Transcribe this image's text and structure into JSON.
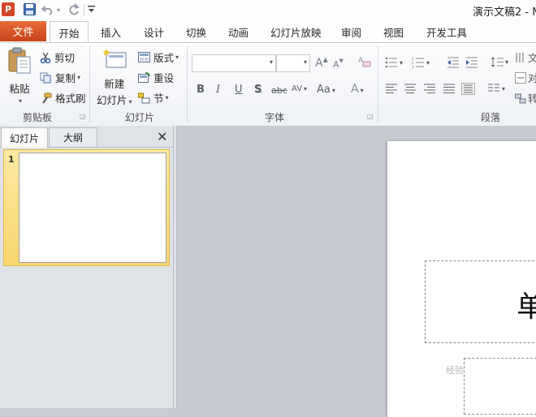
{
  "title_bar": {
    "app_icon_letter": "P",
    "document_title": "演示文稿2 - M"
  },
  "tabs": [
    "文件",
    "开始",
    "插入",
    "设计",
    "切换",
    "动画",
    "幻灯片放映",
    "审阅",
    "视图",
    "开发工具"
  ],
  "active_tab": "开始",
  "ribbon": {
    "clipboard": {
      "paste_label": "粘贴",
      "cut_label": "剪切",
      "copy_label": "复制",
      "format_painter_label": "格式刷",
      "group_label": "剪贴板"
    },
    "slides": {
      "new_slide_line1": "新建",
      "new_slide_line2": "幻灯片",
      "layout_label": "版式",
      "reset_label": "重设",
      "section_label": "节",
      "group_label": "幻灯片"
    },
    "font": {
      "font_name_value": "",
      "font_size_value": "",
      "grow_label": "A",
      "shrink_label": "A",
      "bold_label": "B",
      "italic_label": "I",
      "underline_label": "U",
      "shadow_label": "S",
      "strike_label": "abc",
      "spacing_label": "AV",
      "case_label": "Aa",
      "color_label": "A",
      "group_label": "字体"
    },
    "paragraph": {
      "group_label": "段落",
      "text_direction_label": "文",
      "align_text_label": "对",
      "convert_label": "转"
    }
  },
  "panel": {
    "tab_slides": "幻灯片",
    "tab_outline": "大纲",
    "close_glyph": "✕",
    "slide_number": "1"
  },
  "slide": {
    "title_partial_char": "单"
  },
  "watermark_text": "经验"
}
